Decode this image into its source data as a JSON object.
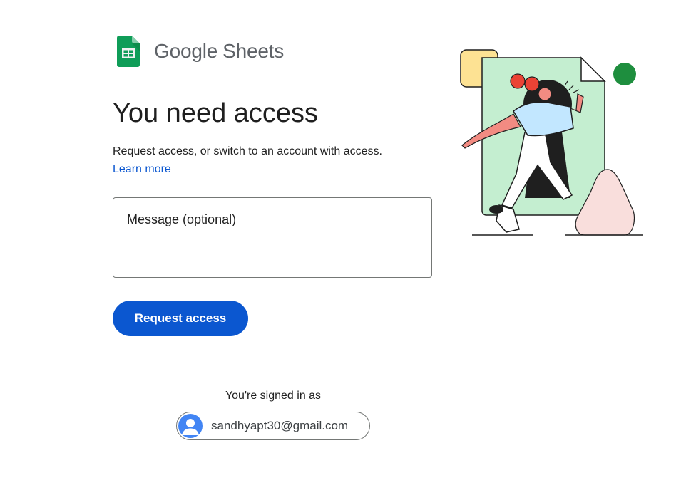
{
  "header": {
    "brand": "Google",
    "product": "Sheets"
  },
  "main": {
    "title": "You need access",
    "description": "Request access, or switch to an account with access.",
    "learn_more": "Learn more",
    "message_placeholder": "Message (optional)",
    "request_button": "Request access"
  },
  "account": {
    "signed_in_label": "You're signed in as",
    "email": "sandhyapt30@gmail.com"
  },
  "colors": {
    "primary": "#0b57d0",
    "sheets_green": "#0f9d58",
    "text": "#1f1f1f"
  },
  "icons": {
    "product_icon": "google-sheets-icon",
    "avatar_icon": "account-circle-icon"
  }
}
